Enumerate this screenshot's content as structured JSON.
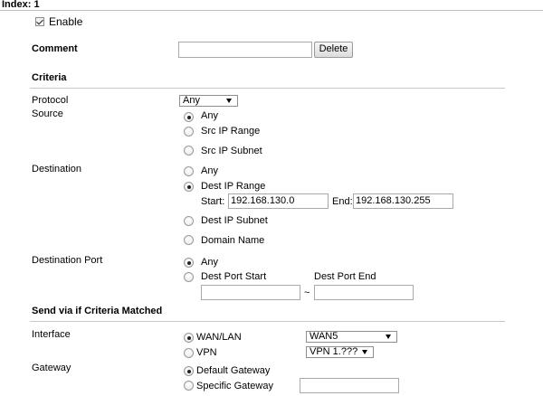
{
  "header": {
    "index_title": "Index: 1"
  },
  "enable": {
    "label": "Enable",
    "checked": true
  },
  "comment": {
    "label": "Comment",
    "value": "",
    "delete_label": "Delete"
  },
  "criteria": {
    "heading": "Criteria",
    "protocol": {
      "label": "Protocol",
      "selected": "Any"
    },
    "source": {
      "label": "Source",
      "options": [
        "Any",
        "Src IP Range",
        "Src IP Subnet"
      ],
      "selected": "Any"
    },
    "destination": {
      "label": "Destination",
      "options": [
        "Any",
        "Dest IP Range",
        "Dest IP Subnet",
        "Domain Name"
      ],
      "selected": "Dest IP Range",
      "start_label": "Start:",
      "start_value": "192.168.130.0",
      "end_label": "End:",
      "end_value": "192.168.130.255"
    },
    "destination_port": {
      "label": "Destination Port",
      "any_label": "Any",
      "start_label": "Dest Port Start",
      "end_label": "Dest Port End",
      "start_value": "",
      "end_value": "",
      "separator": "~",
      "selected": "Any"
    }
  },
  "send_via": {
    "heading": "Send via if Criteria Matched",
    "interface": {
      "label": "Interface",
      "wan_lan_label": "WAN/LAN",
      "vpn_label": "VPN",
      "wan_selected": "WAN5",
      "vpn_selected": "VPN 1.???",
      "selected": "WAN/LAN"
    },
    "gateway": {
      "label": "Gateway",
      "default_label": "Default Gateway",
      "specific_label": "Specific Gateway",
      "specific_value": "",
      "selected": "Default Gateway"
    }
  }
}
